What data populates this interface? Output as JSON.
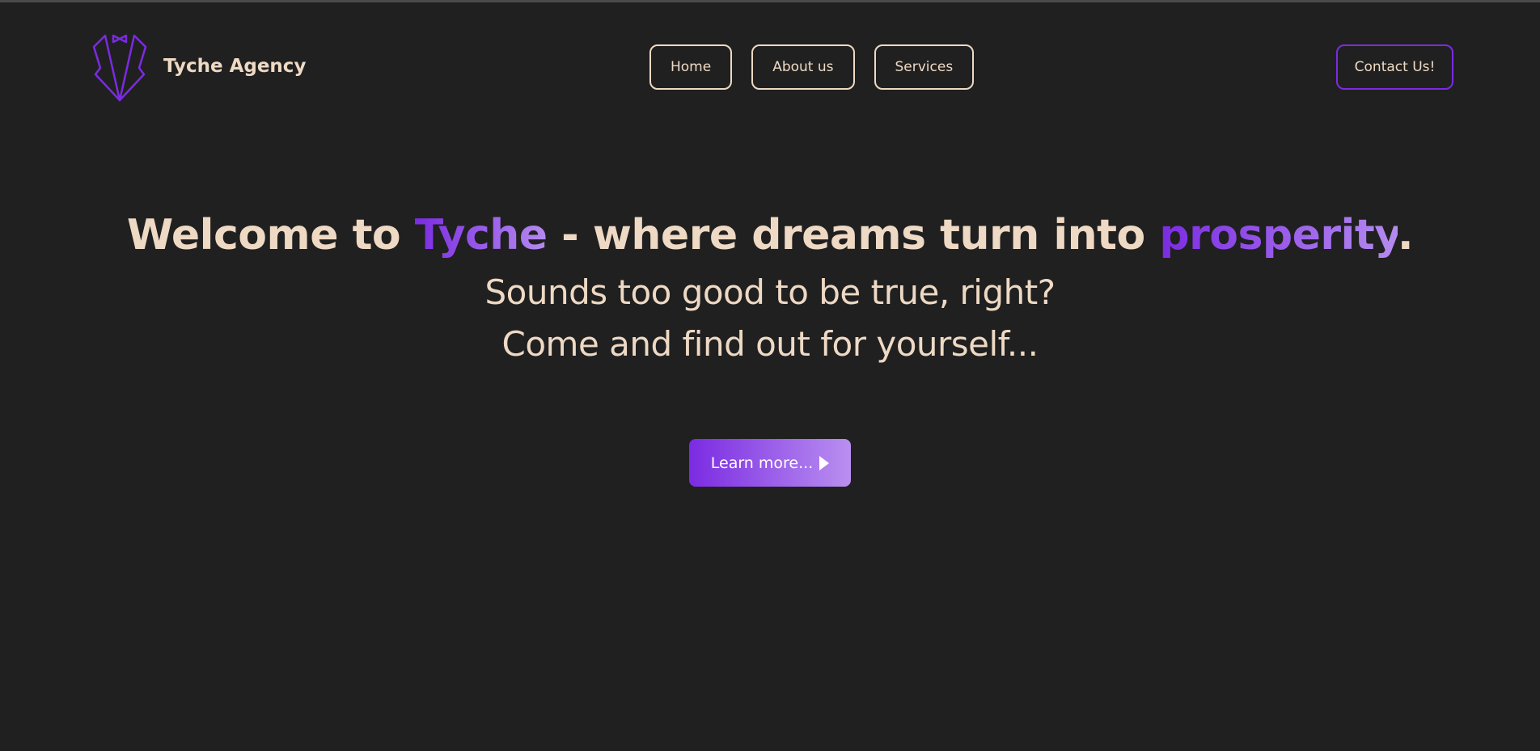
{
  "header": {
    "brand_name": "Tyche Agency",
    "logo_icon": "tuxedo-logo-icon",
    "nav": [
      {
        "label": "Home"
      },
      {
        "label": "About us"
      },
      {
        "label": "Services"
      }
    ],
    "contact_label": "Contact Us!"
  },
  "hero": {
    "title_part1": "Welcome to ",
    "title_accent1": "Tyche",
    "title_part2": " - where dreams turn into ",
    "title_accent2": "prosperity",
    "title_part3": ".",
    "subtitle_line1": "Sounds too good to be true, right?",
    "subtitle_line2": "Come and find out for yourself...",
    "cta_label": "Learn more...",
    "cta_icon": "play-icon"
  },
  "colors": {
    "background": "#202020",
    "text": "#eed9c4",
    "accent_start": "#7b2be2",
    "accent_end": "#b58bef"
  }
}
